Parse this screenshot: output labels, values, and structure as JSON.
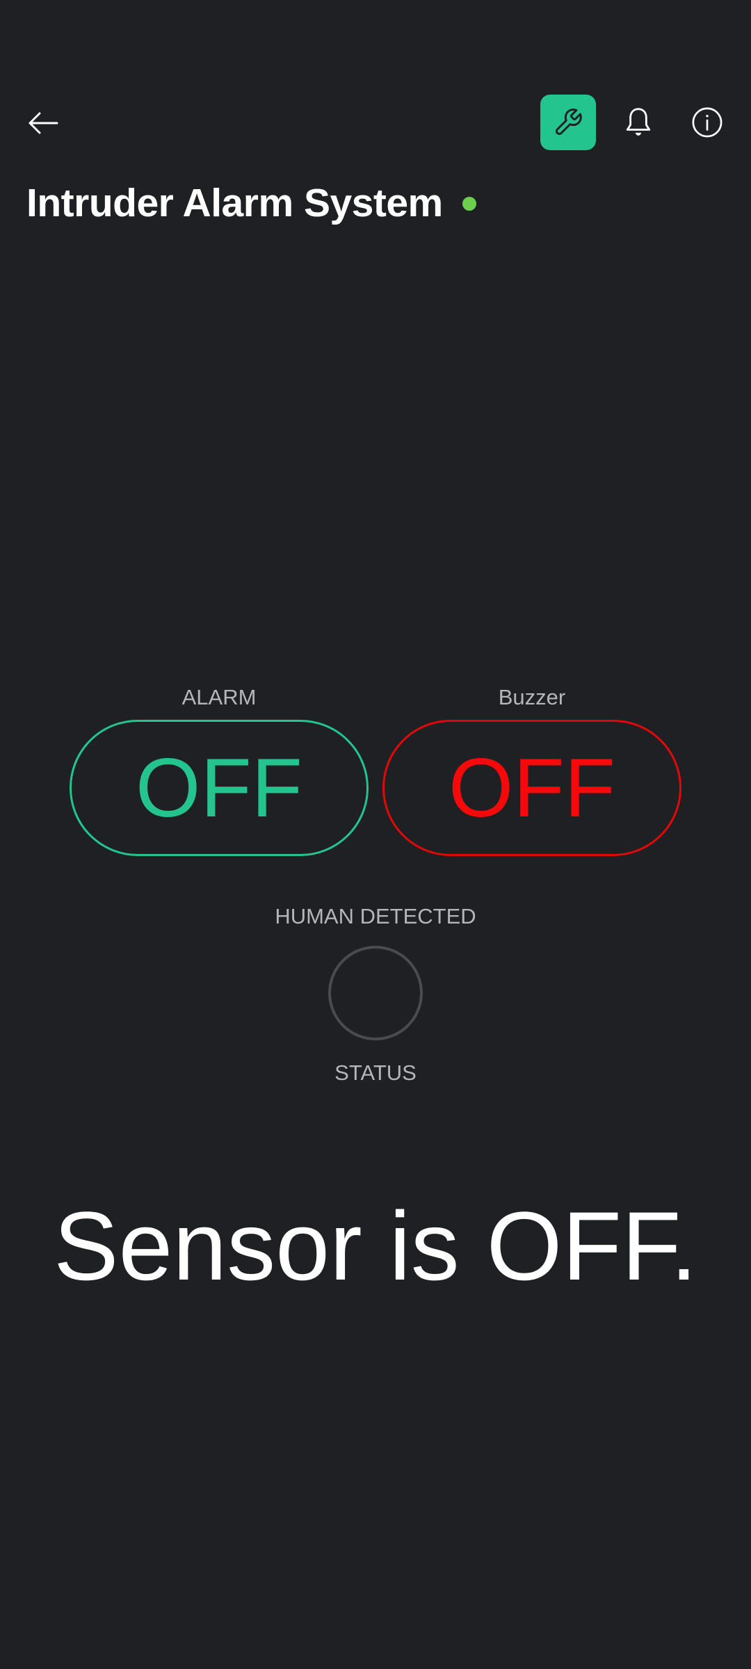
{
  "header": {
    "back_icon": "arrow-left-icon",
    "settings_icon": "wrench-icon",
    "notifications_icon": "bell-icon",
    "info_icon": "info-icon",
    "accent_color": "#23c48e"
  },
  "device": {
    "title": "Intruder Alarm System",
    "status_color": "#6ccf4d"
  },
  "widgets": {
    "alarm": {
      "label": "ALARM",
      "value": "OFF",
      "color": "#23c48e"
    },
    "buzzer": {
      "label": "Buzzer",
      "value": "OFF",
      "color": "#f5090a"
    },
    "led": {
      "label_top": "HUMAN DETECTED",
      "label_bottom": "STATUS",
      "state": "off"
    },
    "sensor_display": {
      "value": "Sensor is OFF."
    }
  }
}
